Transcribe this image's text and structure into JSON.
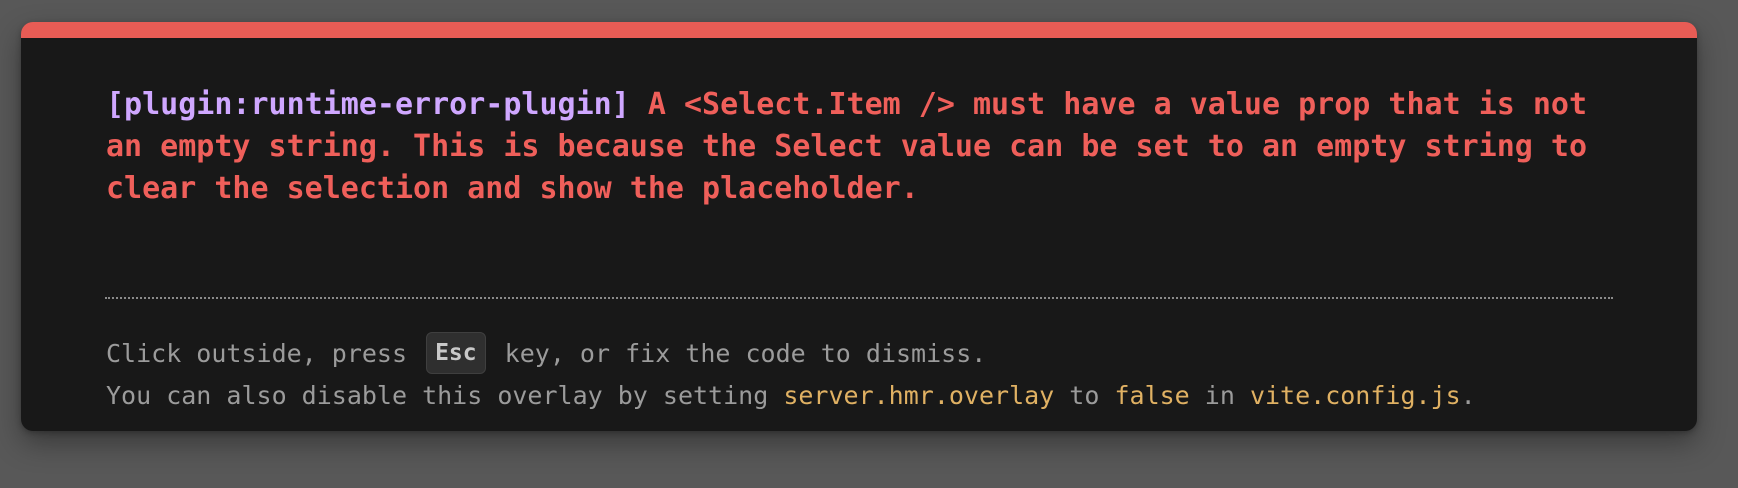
{
  "error": {
    "plugin_tag": "[plugin:runtime-error-plugin]",
    "message": " A <Select.Item /> must have a value prop that is not an empty string. This is because the Select value can be set to an empty string to clear the selection and show the placeholder."
  },
  "tip": {
    "line1_before": "Click outside, press ",
    "key": "Esc",
    "line1_after": " key, or fix the code to dismiss.",
    "line2_part1": "You can also disable this overlay by setting ",
    "line2_code1": "server.hmr.overlay",
    "line2_part2": " to ",
    "line2_code2": "false",
    "line2_part3": " in ",
    "line2_code3": "vite.config.js",
    "line2_part4": "."
  },
  "colors": {
    "accent_bar": "#e85c55",
    "error_text": "#ef5f5a",
    "plugin_text": "#cfa7ff",
    "code_text": "#e0b163",
    "panel_bg": "#181818",
    "backdrop": "#585858"
  }
}
